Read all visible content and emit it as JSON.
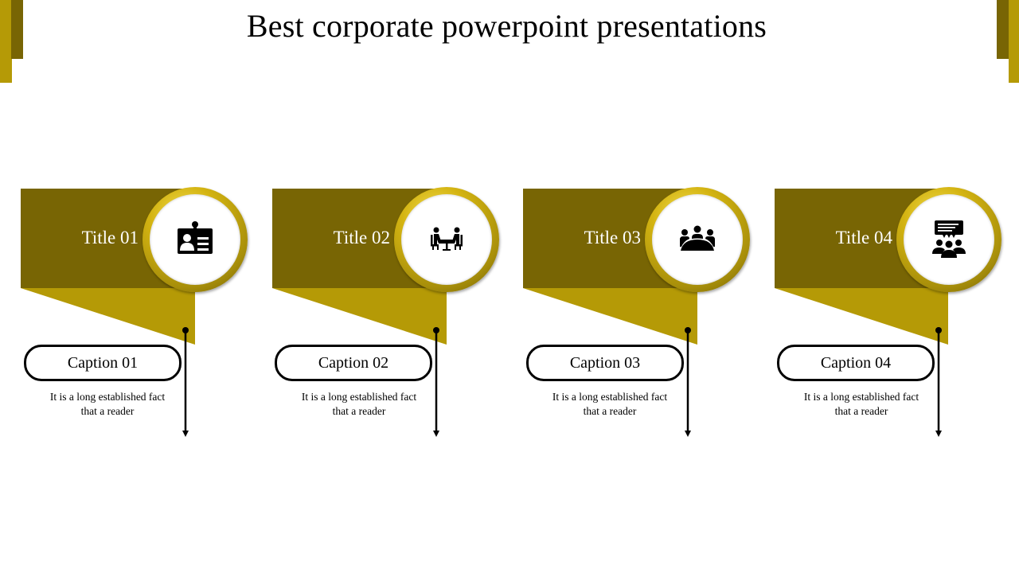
{
  "slide": {
    "title": "Best corporate powerpoint presentations",
    "colors": {
      "dark_band": "#786504",
      "light_band": "#b59a06",
      "ring_gold": "#d4b412",
      "text_dark": "#000000",
      "text_light": "#ffffff"
    }
  },
  "cards": [
    {
      "title": "Title 01",
      "icon": "id-badge-icon",
      "caption": "Caption 01",
      "description_line1": "It is a long established  fact",
      "description_line2": "that a reader"
    },
    {
      "title": "Title 02",
      "icon": "meeting-table-icon",
      "caption": "Caption 02",
      "description_line1": "It is a long established  fact",
      "description_line2": "that a reader"
    },
    {
      "title": "Title 03",
      "icon": "team-conference-icon",
      "caption": "Caption 03",
      "description_line1": "It is a long established  fact",
      "description_line2": "that a reader"
    },
    {
      "title": "Title 04",
      "icon": "group-discussion-icon",
      "caption": "Caption 04",
      "description_line1": "It is a long established  fact",
      "description_line2": "that a reader"
    }
  ]
}
